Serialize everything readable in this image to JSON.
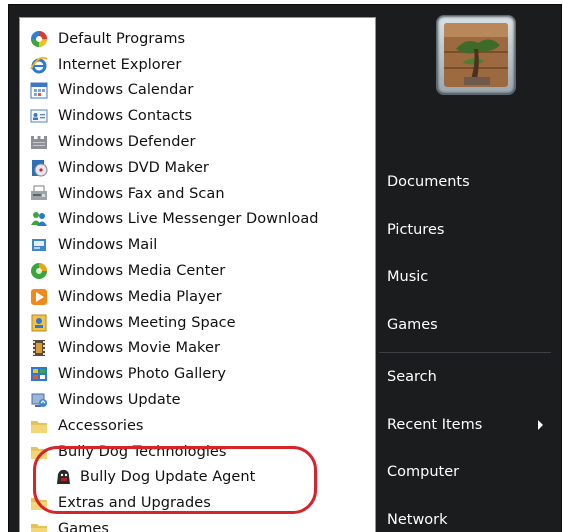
{
  "programs": [
    {
      "label": "Default Programs",
      "icon": "default-programs-icon"
    },
    {
      "label": "Internet Explorer",
      "icon": "internet-explorer-icon"
    },
    {
      "label": "Windows Calendar",
      "icon": "calendar-icon"
    },
    {
      "label": "Windows Contacts",
      "icon": "contacts-icon"
    },
    {
      "label": "Windows Defender",
      "icon": "defender-icon"
    },
    {
      "label": "Windows DVD Maker",
      "icon": "dvd-maker-icon"
    },
    {
      "label": "Windows Fax and Scan",
      "icon": "fax-scan-icon"
    },
    {
      "label": "Windows Live Messenger Download",
      "icon": "messenger-icon"
    },
    {
      "label": "Windows Mail",
      "icon": "mail-icon"
    },
    {
      "label": "Windows Media Center",
      "icon": "media-center-icon"
    },
    {
      "label": "Windows Media Player",
      "icon": "media-player-icon"
    },
    {
      "label": "Windows Meeting Space",
      "icon": "meeting-space-icon"
    },
    {
      "label": "Windows Movie Maker",
      "icon": "movie-maker-icon"
    },
    {
      "label": "Windows Photo Gallery",
      "icon": "photo-gallery-icon"
    },
    {
      "label": "Windows Update",
      "icon": "windows-update-icon"
    },
    {
      "label": "Accessories",
      "icon": "folder-icon"
    },
    {
      "label": "Bully Dog Technologies",
      "icon": "folder-icon"
    },
    {
      "label": "Bully Dog Update Agent",
      "icon": "bully-dog-agent-icon"
    },
    {
      "label": "Extras and Upgrades",
      "icon": "folder-icon"
    },
    {
      "label": "Games",
      "icon": "folder-icon"
    }
  ],
  "right_menu": {
    "documents": "Documents",
    "pictures": "Pictures",
    "music": "Music",
    "games": "Games",
    "search": "Search",
    "recent_items": "Recent Items",
    "computer": "Computer",
    "network": "Network"
  },
  "colors": {
    "menu_background": "#1b1c1e",
    "highlight_ring": "#d8232a"
  }
}
